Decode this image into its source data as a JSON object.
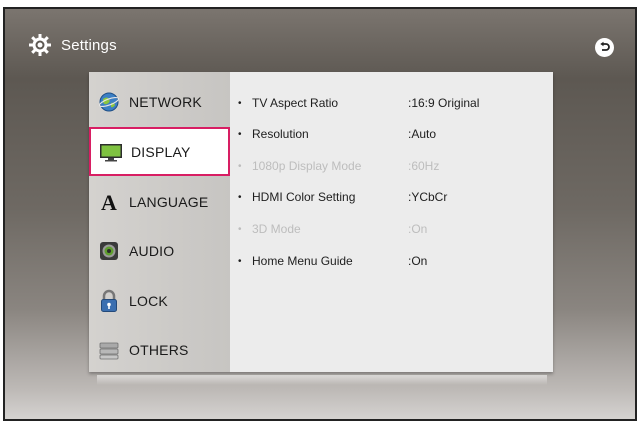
{
  "header": {
    "title": "Settings"
  },
  "sidebar": {
    "items": [
      {
        "label": "NETWORK",
        "icon": "network-globe-icon"
      },
      {
        "label": "DISPLAY",
        "icon": "monitor-icon",
        "selected": true
      },
      {
        "label": "LANGUAGE",
        "icon": "letter-a-icon"
      },
      {
        "label": "AUDIO",
        "icon": "speaker-icon"
      },
      {
        "label": "LOCK",
        "icon": "padlock-icon"
      },
      {
        "label": "OTHERS",
        "icon": "others-icon"
      }
    ]
  },
  "settings": [
    {
      "name": "TV Aspect Ratio",
      "value": ":16:9 Original",
      "enabled": true
    },
    {
      "name": "Resolution",
      "value": ":Auto",
      "enabled": true
    },
    {
      "name": "1080p Display Mode",
      "value": ":60Hz",
      "enabled": false
    },
    {
      "name": "HDMI Color Setting",
      "value": ":YCbCr",
      "enabled": true
    },
    {
      "name": "3D Mode",
      "value": ":On",
      "enabled": false
    },
    {
      "name": "Home Menu Guide",
      "value": ":On",
      "enabled": true
    }
  ],
  "bullet": "•",
  "colors": {
    "selection_border": "#d81e63"
  }
}
